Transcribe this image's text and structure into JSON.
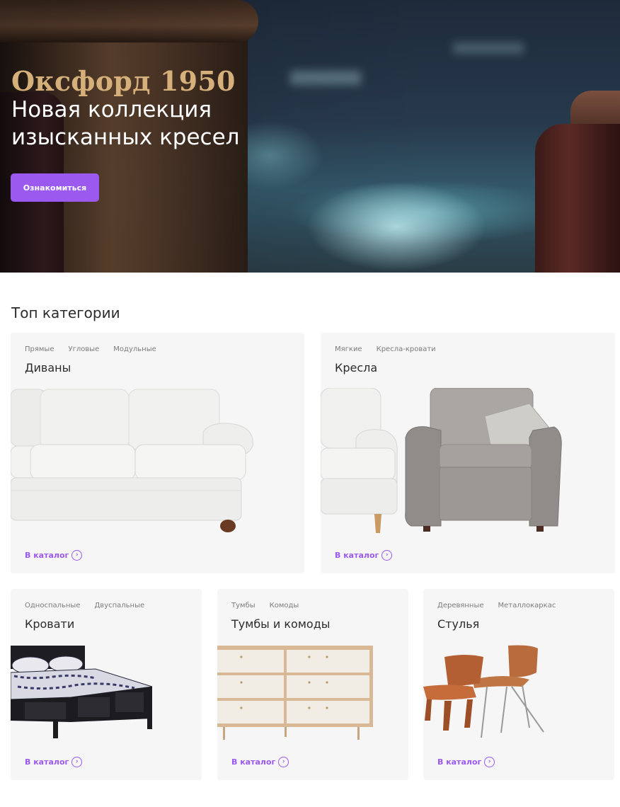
{
  "hero": {
    "title": "Оксфорд 1950",
    "subtitle": "Новая коллекция изысканных кресел",
    "button_label": "Ознакомиться"
  },
  "section": {
    "title": "Топ категории"
  },
  "categories": [
    {
      "name": "Диваны",
      "tags": [
        "Прямые",
        "Угловые",
        "Модульные"
      ],
      "link": "В каталог"
    },
    {
      "name": "Кресла",
      "tags": [
        "Мягкие",
        "Кресла-кровати"
      ],
      "link": "В каталог"
    },
    {
      "name": "Кровати",
      "tags": [
        "Односпальные",
        "Двуспальные"
      ],
      "link": "В каталог"
    },
    {
      "name": "Тумбы и комоды",
      "tags": [
        "Тумбы",
        "Комоды"
      ],
      "link": "В каталог"
    },
    {
      "name": "Стулья",
      "tags": [
        "Деревянные",
        "Металлокаркас"
      ],
      "link": "В каталог"
    }
  ],
  "colors": {
    "accent": "#9b59f0",
    "title_gold": "#d6b07a",
    "card_bg": "#f6f6f6"
  },
  "icons": {
    "link_arrow": "chevron-right-circle-icon"
  }
}
